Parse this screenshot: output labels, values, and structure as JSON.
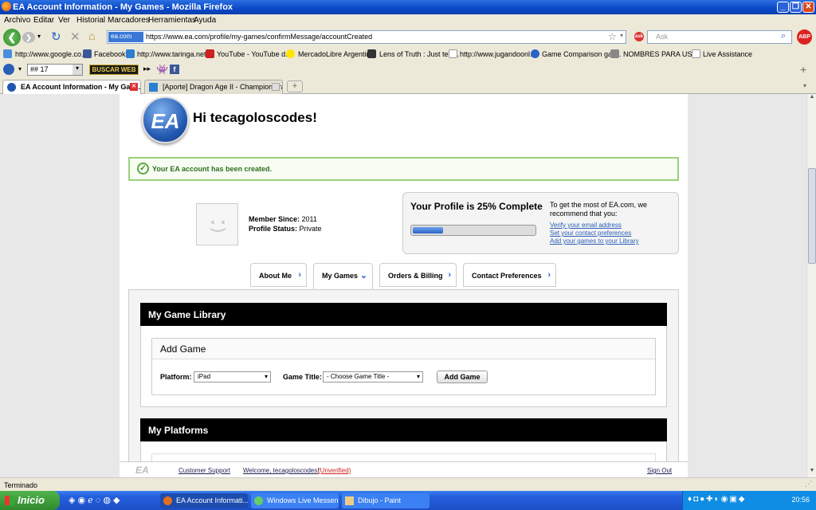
{
  "window": {
    "title": "EA Account Information - My Games - Mozilla Firefox"
  },
  "menu": [
    "Archivo",
    "Editar",
    "Ver",
    "Historial",
    "Marcadores",
    "Herramientas",
    "Ayuda"
  ],
  "nav": {
    "site_badge": "ea.com",
    "url": "https://www.ea.com/profile/my-games/confirmMessage/accountCreated",
    "search_placeholder": "Ask"
  },
  "bookmarks": [
    "http://www.google.co...",
    "Facebook",
    "http://www.taringa.net/",
    "YouTube - YouTube d...",
    "MercadoLibre Argentin...",
    "Lens of Truth : Just telli...",
    "http://www.jugandoonl...",
    "Game Comparison gall...",
    "NOMBRES PARA US...",
    "Live Assistance"
  ],
  "toolbar": {
    "combo_value": "## 17",
    "buscar_label": "BUSCAR WEB"
  },
  "tabs": [
    {
      "label": "EA Account Information - My Gam..."
    },
    {
      "label": "[Aporte] Dragon Age II - Champion Traile..."
    }
  ],
  "page": {
    "logo_text": "EA",
    "greeting": "Hi tecagoloscodes!",
    "success_message": "Your EA account has been created.",
    "member_since_label": "Member Since:",
    "member_since_value": "2011",
    "profile_status_label": "Profile Status:",
    "profile_status_value": "Private",
    "profile_complete_title": "Your Profile is 25% Complete",
    "profile_progress": 0.25,
    "profile_tip": "To get the most of EA.com, we recommend that you:",
    "profile_links": [
      "Verify your email address",
      "Set your contact preferences",
      "Add your games to your Library"
    ],
    "profile_tabs": [
      "About Me",
      "My Games",
      "Orders & Billing",
      "Contact Preferences"
    ],
    "library_title": "My Game Library",
    "add_game_title": "Add Game",
    "platform_label": "Platform:",
    "platform_value": "iPad",
    "game_title_label": "Game Title:",
    "game_title_value": "- Choose Game Title -",
    "add_game_button": "Add Game",
    "platforms_title": "My Platforms",
    "footer": {
      "logo": "EA",
      "support": "Customer Support",
      "welcome": "Welcome, tecagoloscodes!",
      "unverified": "(Unverified)",
      "signout": "Sign Out"
    }
  },
  "status": {
    "text": "Terminado"
  },
  "taskbar": {
    "start": "Inicio",
    "tasks": [
      "EA Account Informati...",
      "Windows Live Messen...",
      "Dibujo - Paint"
    ],
    "clock": "20:56"
  },
  "colors": {
    "ea_blue": "#2056b0",
    "success_green": "#9ad27a",
    "xp_taskbar": "#245edb",
    "start_green": "#2f8a2c"
  }
}
